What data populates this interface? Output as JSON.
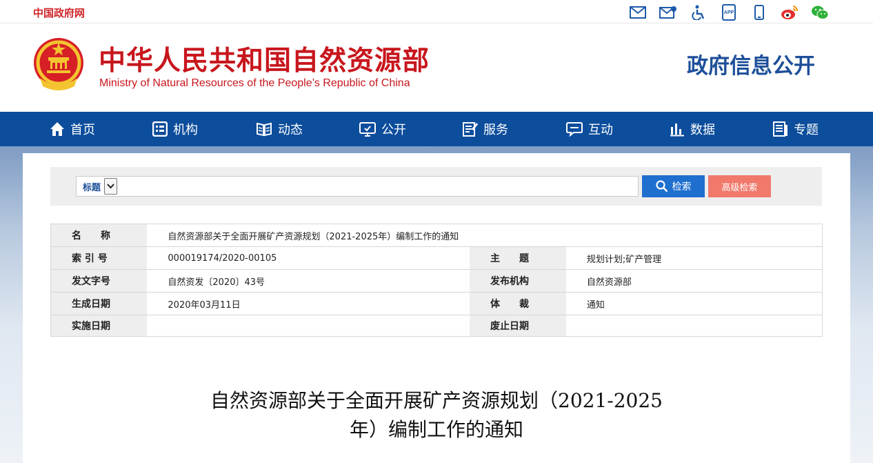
{
  "topbar": {
    "gov_link": "中国政府网",
    "icons": [
      "mail-icon",
      "mail-settings-icon",
      "accessibility-icon",
      "app-icon",
      "mobile-icon",
      "weibo-icon",
      "wechat-icon"
    ],
    "app_label": "APP"
  },
  "header": {
    "title_cn": "中华人民共和国自然资源部",
    "title_en": "Ministry of Natural Resources of the People’s Republic of China",
    "right_title": "政府信息公开"
  },
  "nav": {
    "items": [
      {
        "label": "首页",
        "icon": "home-icon"
      },
      {
        "label": "机构",
        "icon": "org-icon"
      },
      {
        "label": "动态",
        "icon": "news-icon"
      },
      {
        "label": "公开",
        "icon": "disclosure-icon"
      },
      {
        "label": "服务",
        "icon": "service-icon"
      },
      {
        "label": "互动",
        "icon": "chat-icon"
      },
      {
        "label": "数据",
        "icon": "data-icon"
      },
      {
        "label": "专题",
        "icon": "topic-icon"
      }
    ]
  },
  "search": {
    "select_value": "标题",
    "input_value": "",
    "search_label": "检索",
    "advanced_label": "高级检索"
  },
  "info": {
    "name_label": "名　　称",
    "name_value": "自然资源部关于全面开展矿产资源规划（2021-2025年）编制工作的通知",
    "index_label": "索 引 号",
    "index_value": "000019174/2020-00105",
    "topic_label": "主　　题",
    "topic_value": "规划计划;矿产管理",
    "docno_label": "发文字号",
    "docno_value": "自然资发〔2020〕43号",
    "issuer_label": "发布机构",
    "issuer_value": "自然资源部",
    "date_label": "生成日期",
    "date_value": "2020年03月11日",
    "genre_label": "体　　裁",
    "genre_value": "通知",
    "effective_label": "实施日期",
    "effective_value": "",
    "expire_label": "废止日期",
    "expire_value": ""
  },
  "document": {
    "title_line1": "自然资源部关于全面开展矿产资源规划（2021-2025",
    "title_line2": "年）编制工作的通知"
  },
  "colors": {
    "brand_red": "#c8161d",
    "nav_blue": "#0c4d9c",
    "title_blue": "#1d4f99",
    "search_blue": "#1f6fcf",
    "advanced_salmon": "#f0796c"
  }
}
